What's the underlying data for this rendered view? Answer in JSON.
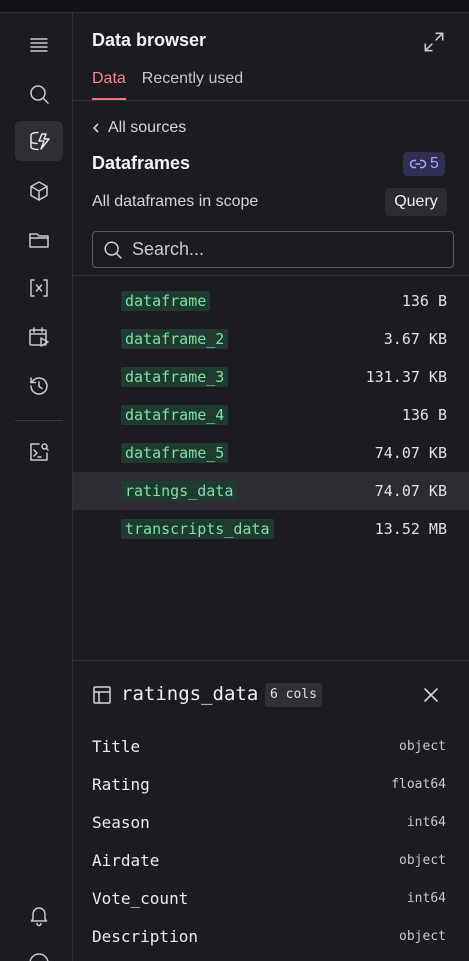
{
  "rail": {
    "icons": [
      "menu-icon",
      "search-icon",
      "data-browser-icon",
      "package-icon",
      "folder-icon",
      "variables-icon",
      "scheduled-run-icon",
      "history-icon",
      "scratchpad-icon",
      "bell-icon"
    ]
  },
  "header": {
    "title": "Data browser",
    "tabs": [
      {
        "label": "Data",
        "active": true
      },
      {
        "label": "Recently used",
        "active": false
      }
    ]
  },
  "browser": {
    "back_label": "All sources",
    "section_title": "Dataframes",
    "count": "5",
    "scope_text": "All dataframes in scope",
    "query_label": "Query",
    "search_placeholder": "Search..."
  },
  "dataframes": [
    {
      "name": "dataframe",
      "size": "136 B"
    },
    {
      "name": "dataframe_2",
      "size": "3.67 KB"
    },
    {
      "name": "dataframe_3",
      "size": "131.37 KB"
    },
    {
      "name": "dataframe_4",
      "size": "136 B"
    },
    {
      "name": "dataframe_5",
      "size": "74.07 KB"
    },
    {
      "name": "ratings_data",
      "size": "74.07 KB",
      "selected": true
    },
    {
      "name": "transcripts_data",
      "size": "13.52 MB"
    }
  ],
  "detail": {
    "name": "ratings_data",
    "cols_badge": "6 cols",
    "columns": [
      {
        "name": "Title",
        "type": "object"
      },
      {
        "name": "Rating",
        "type": "float64"
      },
      {
        "name": "Season",
        "type": "int64"
      },
      {
        "name": "Airdate",
        "type": "object"
      },
      {
        "name": "Vote_count",
        "type": "int64"
      },
      {
        "name": "Description",
        "type": "object"
      }
    ]
  },
  "colors": {
    "accent_tab": "#f07575",
    "badge_purple": "#a8a4ff",
    "chip_green": "#7fe0a8"
  }
}
